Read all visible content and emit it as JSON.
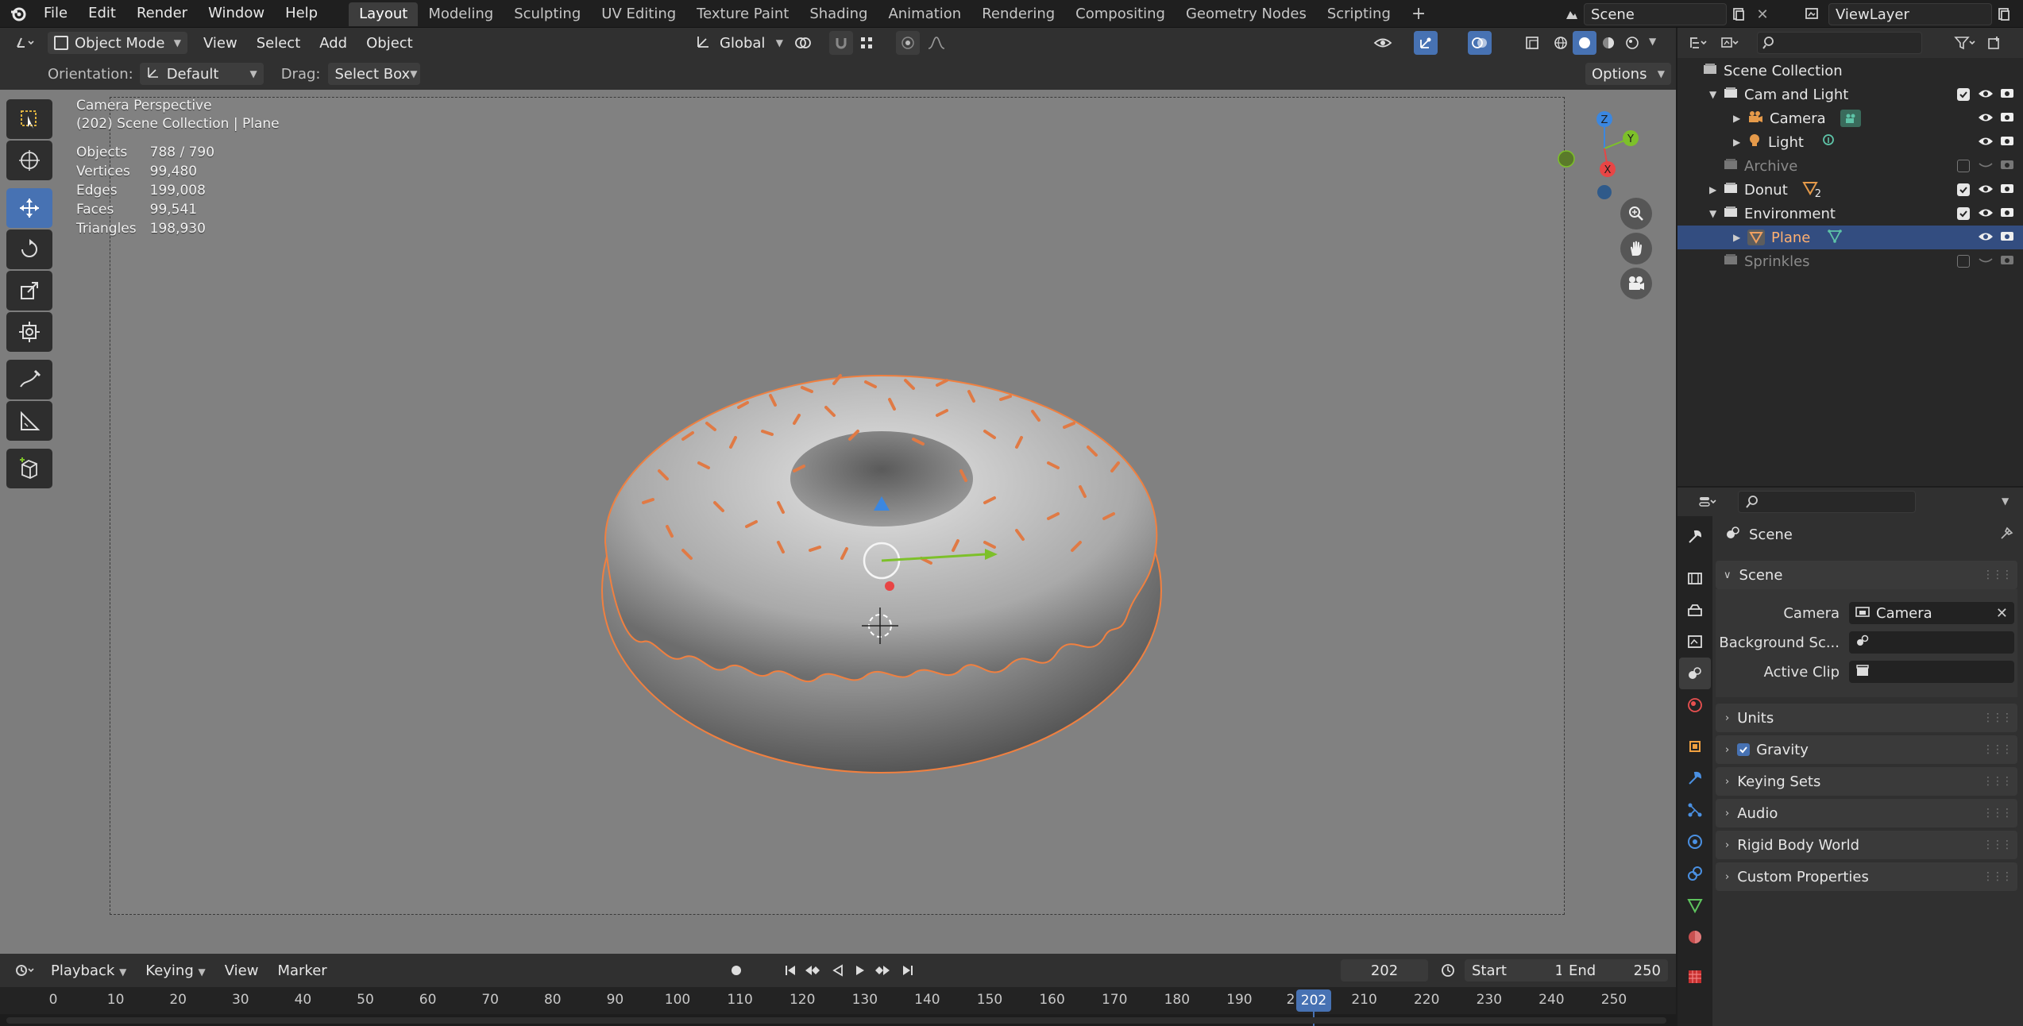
{
  "colors": {
    "accent": "#4772b3",
    "selection_outline": "#f08040",
    "viewport_bg": "#7d7d7d",
    "timeline_current": "#4772b3",
    "axis_x": "#e84545",
    "axis_y": "#7dc02a",
    "axis_z": "#3b87e0"
  },
  "top_menu": [
    "File",
    "Edit",
    "Render",
    "Window",
    "Help"
  ],
  "workspace_tabs": [
    "Layout",
    "Modeling",
    "Sculpting",
    "UV Editing",
    "Texture Paint",
    "Shading",
    "Animation",
    "Rendering",
    "Compositing",
    "Geometry Nodes",
    "Scripting"
  ],
  "active_workspace": "Layout",
  "scene_name": "Scene",
  "view_layer": "ViewLayer",
  "viewport_header": {
    "mode": "Object Mode",
    "menus": [
      "View",
      "Select",
      "Add",
      "Object"
    ],
    "transform_orientation": "Global"
  },
  "tool_settings": {
    "orientation_label": "Orientation:",
    "orientation_value": "Default",
    "drag_label": "Drag:",
    "drag_value": "Select Box",
    "options_label": "Options"
  },
  "viewport_info": {
    "title": "Camera Perspective",
    "subtitle": "(202) Scene Collection | Plane",
    "stats": [
      {
        "label": "Objects",
        "value": "788 / 790"
      },
      {
        "label": "Vertices",
        "value": "99,480"
      },
      {
        "label": "Edges",
        "value": "199,008"
      },
      {
        "label": "Faces",
        "value": "99,541"
      },
      {
        "label": "Triangles",
        "value": "198,930"
      }
    ]
  },
  "gizmo_labels": {
    "x": "X",
    "y": "Y",
    "z": "Z"
  },
  "toolbar_tools": [
    "select-box",
    "cursor",
    "move",
    "rotate",
    "scale",
    "transform",
    "annotate",
    "measure",
    "add-cube"
  ],
  "outliner": {
    "root": "Scene Collection",
    "items": [
      {
        "name": "Cam and Light",
        "kind": "collection"
      },
      {
        "name": "Camera",
        "kind": "object"
      },
      {
        "name": "Light",
        "kind": "object"
      },
      {
        "name": "Archive",
        "kind": "collection-disabled"
      },
      {
        "name": "Donut",
        "kind": "collection",
        "badge": "2"
      },
      {
        "name": "Environment",
        "kind": "collection"
      },
      {
        "name": "Plane",
        "kind": "object-selected"
      },
      {
        "name": "Sprinkles",
        "kind": "collection-disabled"
      }
    ]
  },
  "properties": {
    "context_title": "Scene",
    "panel_title": "Scene",
    "fields": [
      {
        "label": "Camera",
        "value": "Camera"
      },
      {
        "label": "Background Sc...",
        "value": ""
      },
      {
        "label": "Active Clip",
        "value": ""
      }
    ],
    "collapsed_panels": [
      "Units",
      "Gravity",
      "Keying Sets",
      "Audio",
      "Rigid Body World",
      "Custom Properties"
    ]
  },
  "timeline": {
    "menus": [
      "Playback",
      "Keying",
      "View",
      "Marker"
    ],
    "current_frame": "202",
    "start_label": "Start",
    "start_value": "1",
    "end_label": "End",
    "end_value": "250",
    "ruler_ticks": [
      "0",
      "10",
      "20",
      "30",
      "40",
      "50",
      "60",
      "70",
      "80",
      "90",
      "100",
      "110",
      "120",
      "130",
      "140",
      "150",
      "160",
      "170",
      "180",
      "190",
      "2",
      "210",
      "220",
      "230",
      "240",
      "250"
    ],
    "current_frame_marker": "202"
  }
}
